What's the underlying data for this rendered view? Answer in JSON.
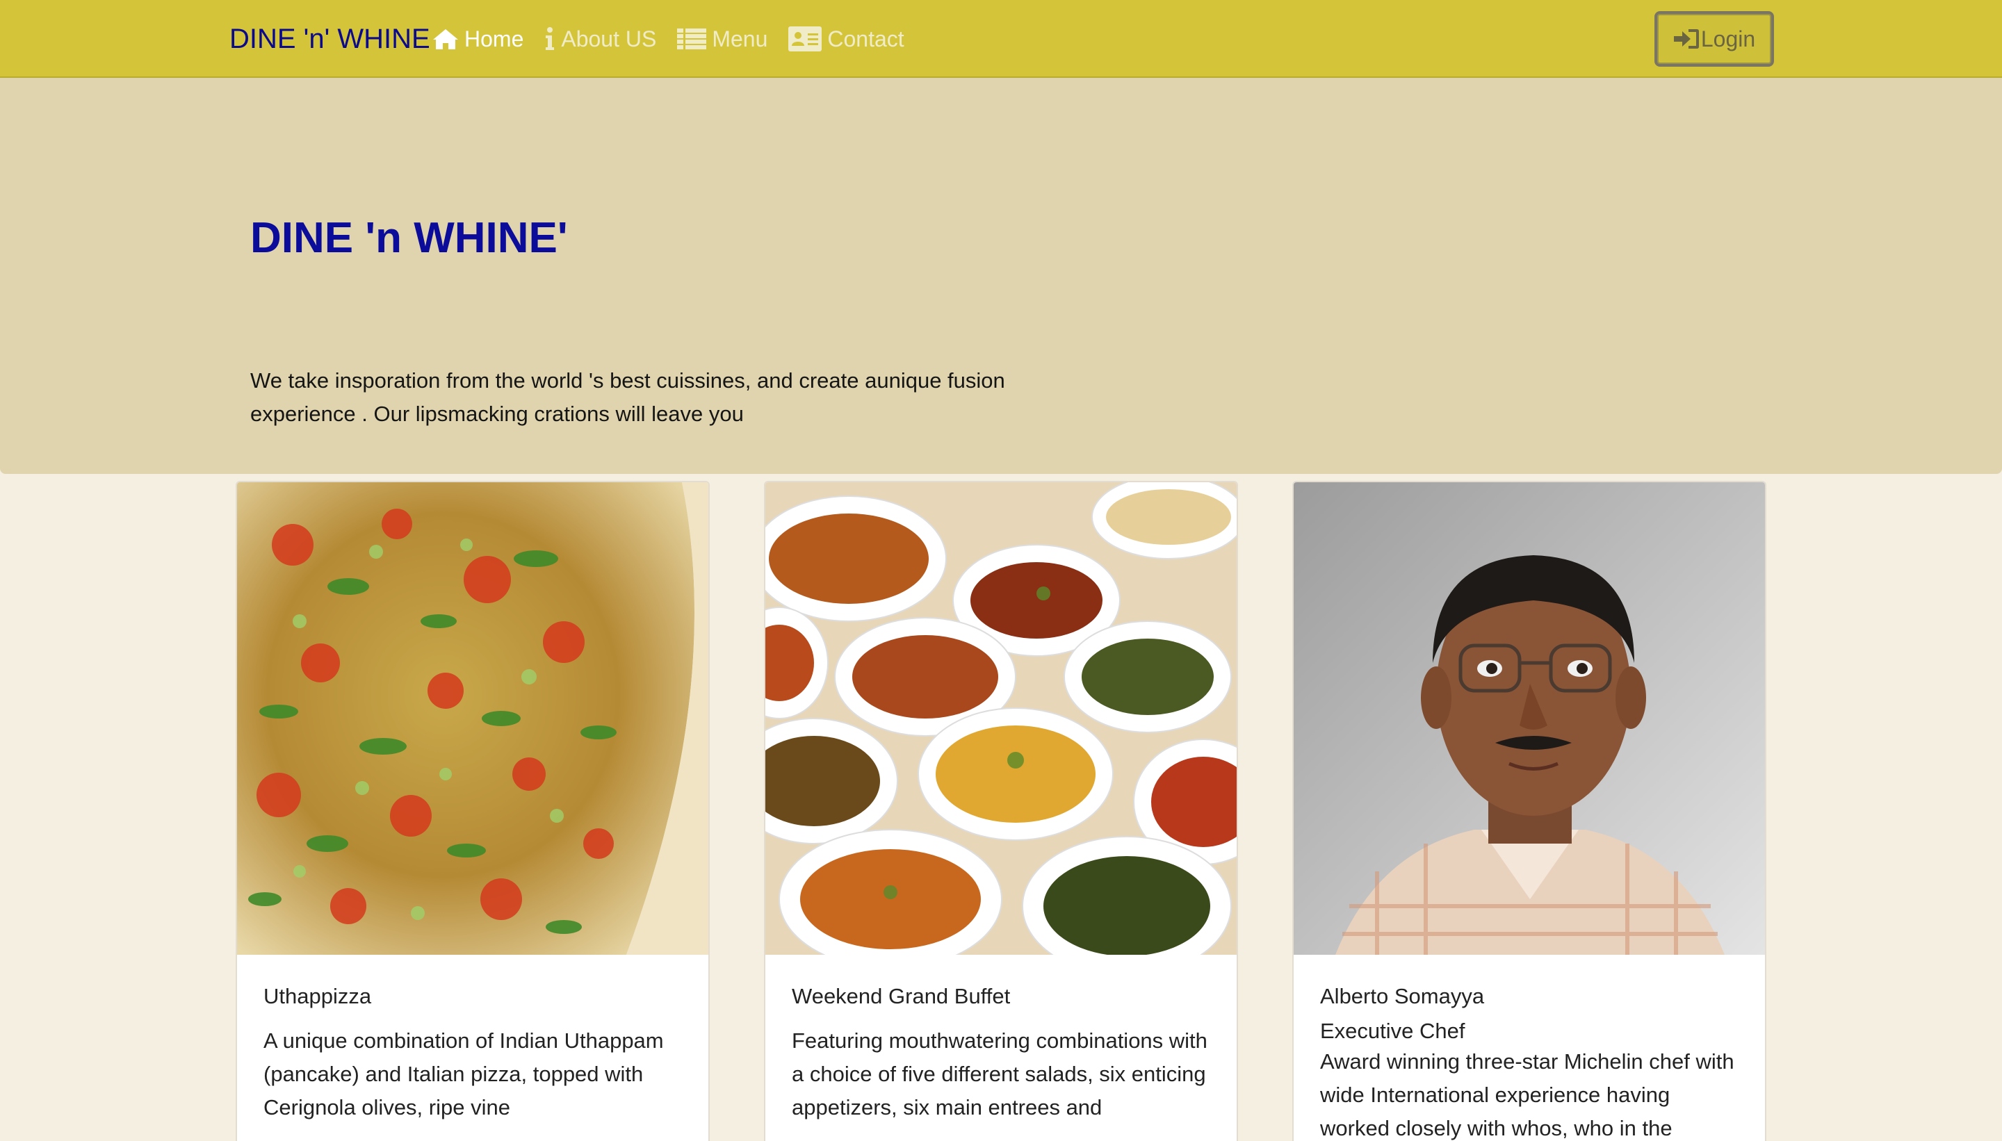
{
  "navbar": {
    "brand": "DINE 'n' WHINE",
    "items": [
      {
        "label": "Home",
        "icon": "home-icon",
        "active": true
      },
      {
        "label": "About US",
        "icon": "info-icon",
        "active": false
      },
      {
        "label": "Menu",
        "icon": "list-icon",
        "active": false
      },
      {
        "label": "Contact",
        "icon": "address-card-icon",
        "active": false
      }
    ],
    "login_label": "Login",
    "login_icon": "sign-in-icon"
  },
  "hero": {
    "title": "DINE 'n WHINE'",
    "text": "We take insporation from the world 's best cuissines, and create aunique fusion experience . Our lipsmacking crations will leave you"
  },
  "cards": [
    {
      "title": "Uthappizza",
      "subtitle": "",
      "text": "A unique combination of Indian Uthappam (pancake) and Italian pizza, topped with Cerignola olives, ripe vine"
    },
    {
      "title": "Weekend Grand Buffet",
      "subtitle": "",
      "text": "Featuring mouthwatering combinations with a choice of five different salads, six enticing appetizers, six main entrees and"
    },
    {
      "title": "Alberto Somayya",
      "subtitle": "Executive Chef",
      "text": "Award winning three-star Michelin chef with wide International experience having worked closely with whos, who in the"
    }
  ],
  "colors": {
    "navbar": "#d4c43a",
    "brand": "#0a0a8a",
    "jumbotron": "#dfd4ad",
    "hero_title": "#0c0c9a",
    "page_bg": "#f5efe2"
  }
}
